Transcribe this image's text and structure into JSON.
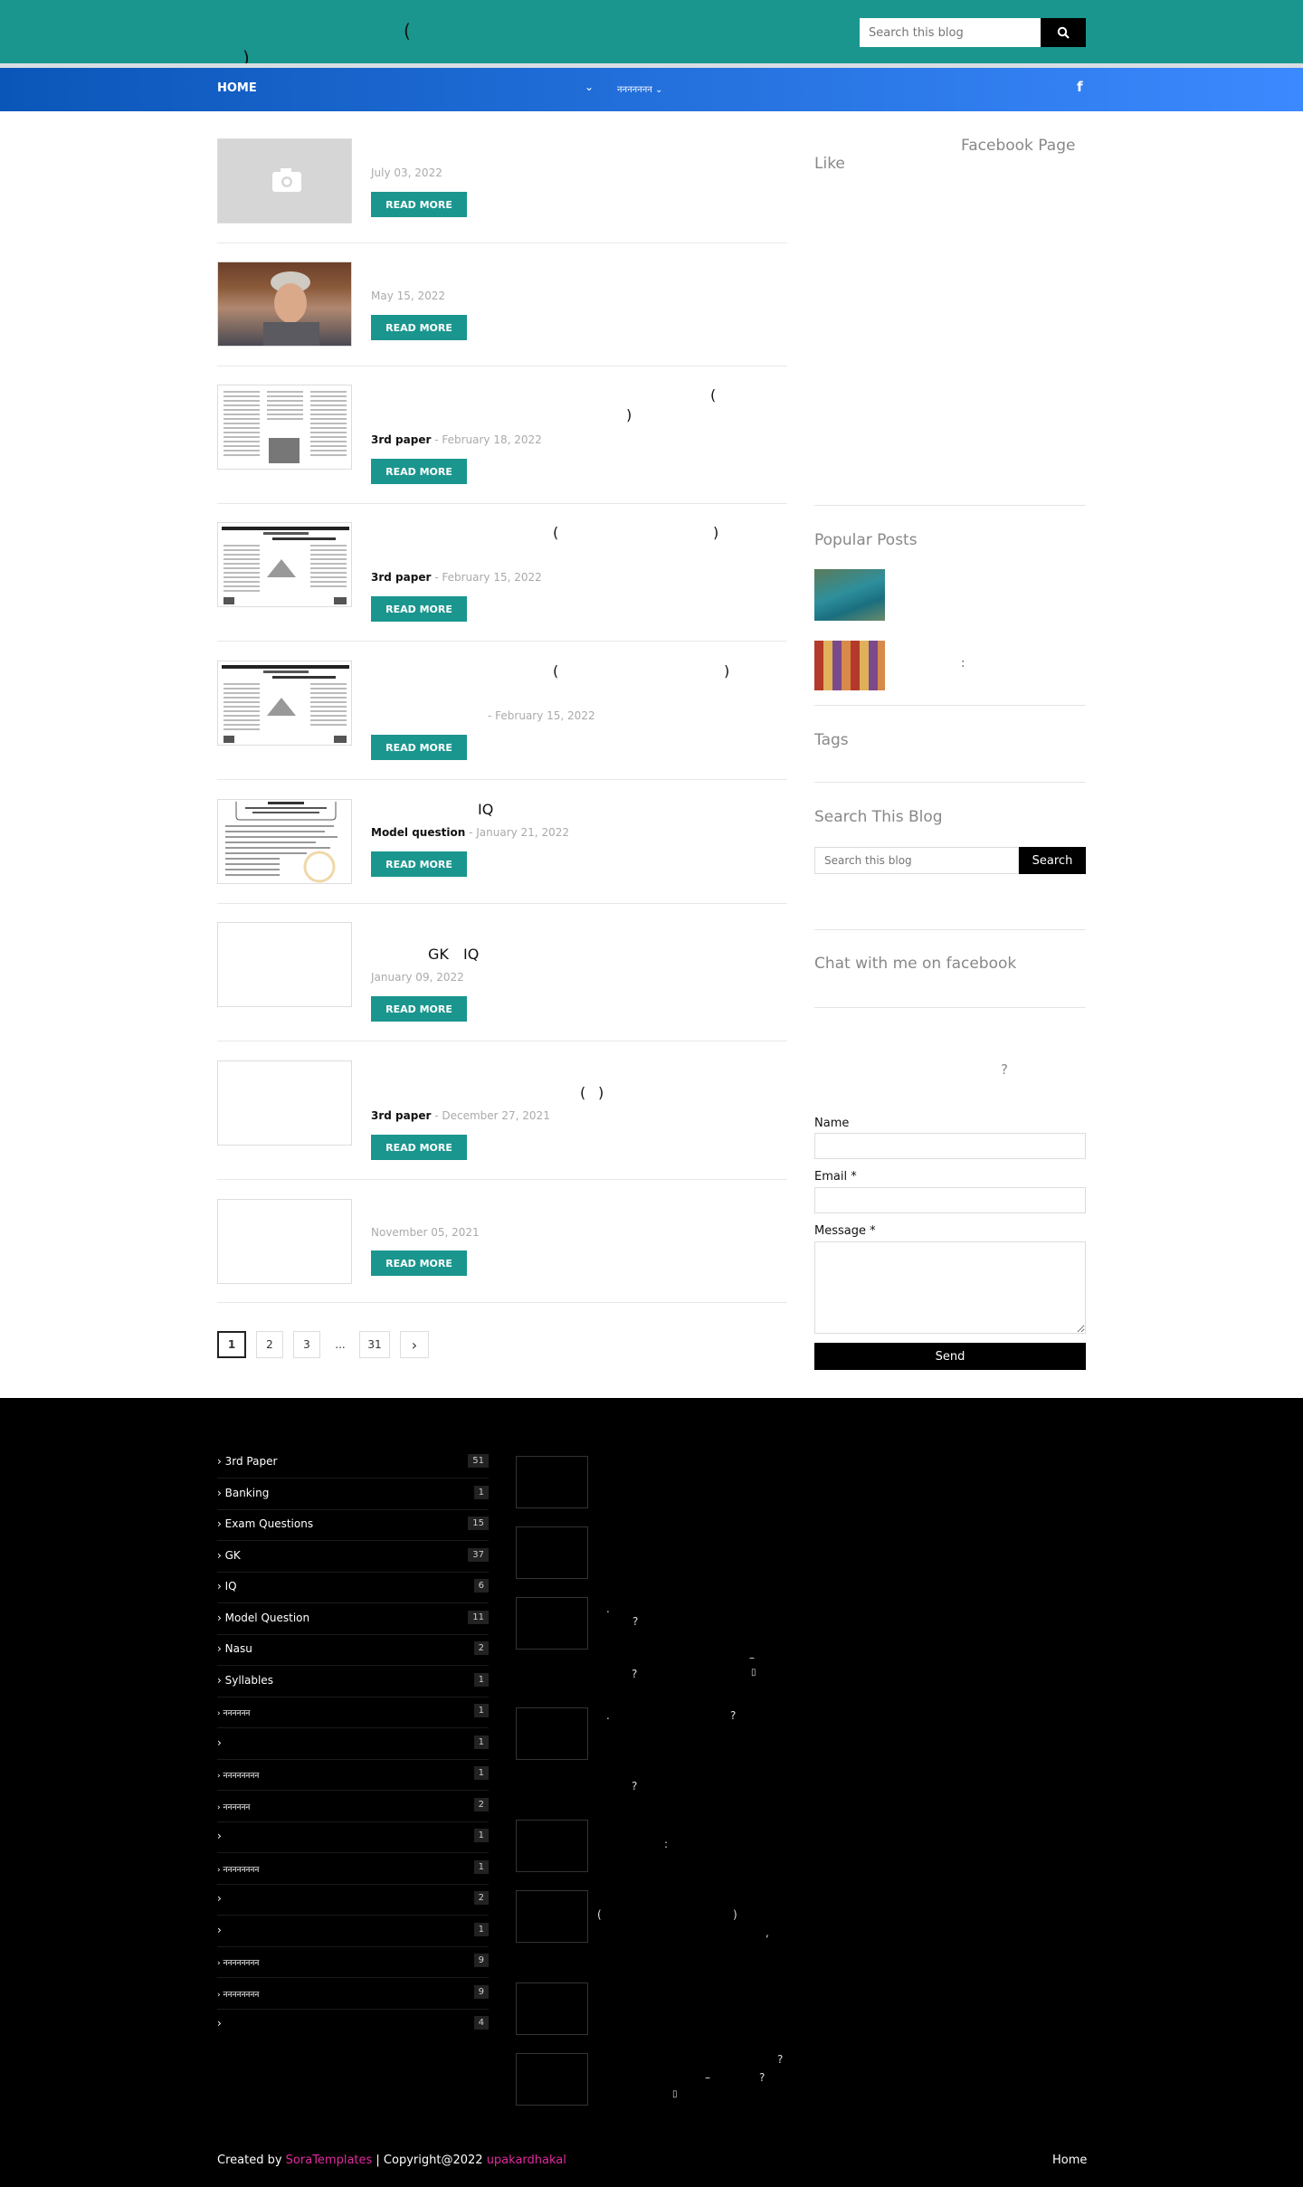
{
  "header": {
    "title_line1": "(",
    "title_line2": ")",
    "search_placeholder": "Search this blog",
    "search_icon": "magnifier-icon"
  },
  "nav": {
    "home": "HOME",
    "dropdown1_chevron": "⌄",
    "dropdown2": "ननननननन ⌄",
    "facebook": "f"
  },
  "posts": [
    {
      "title": "",
      "date": "July 03, 2022",
      "label": "",
      "read_more": "READ MORE"
    },
    {
      "title": "",
      "date": "May 15, 2022",
      "label": "",
      "read_more": "READ MORE"
    },
    {
      "title_a": "(",
      "title_b": ")",
      "label": "3rd paper",
      "date": "February 18, 2022",
      "read_more": "READ MORE"
    },
    {
      "title_a": "(",
      "title_b": ")",
      "label": "3rd paper",
      "date": "February 15, 2022",
      "read_more": "READ MORE"
    },
    {
      "title_a": "(",
      "title_b": ")",
      "label": "",
      "date": "February 15, 2022",
      "read_more": "READ MORE"
    },
    {
      "title": "IQ",
      "label": "Model question",
      "date": "January 21, 2022",
      "read_more": "READ MORE"
    },
    {
      "title_a": "GK",
      "title_b": "IQ",
      "label": "",
      "date": "January 09, 2022",
      "read_more": "READ MORE"
    },
    {
      "title_a": "(",
      "title_b": ")",
      "label": "3rd paper",
      "date": "December 27, 2021",
      "read_more": "READ MORE"
    },
    {
      "title": "",
      "label": "",
      "date": "November 05, 2021",
      "read_more": "READ MORE"
    }
  ],
  "pagination": [
    "1",
    "2",
    "3",
    "...",
    "31",
    "›"
  ],
  "sidebar": {
    "facebook_heading": "Facebook Page",
    "facebook_like": "Like",
    "popular_heading": "Popular Posts",
    "popular_colon": ":",
    "tags_heading": "Tags",
    "search_heading": "Search This Blog",
    "search_placeholder": "Search this blog",
    "search_button": "Search",
    "chat_heading": "Chat with me on facebook",
    "contact_question": "?",
    "name_label": "Name",
    "email_label": "Email *",
    "message_label": "Message *",
    "send": "Send"
  },
  "footer": {
    "categories": [
      {
        "name": "› 3rd Paper",
        "count": "51"
      },
      {
        "name": "› Banking",
        "count": "1"
      },
      {
        "name": "› Exam Questions",
        "count": "15"
      },
      {
        "name": "› GK",
        "count": "37"
      },
      {
        "name": "› IQ",
        "count": "6"
      },
      {
        "name": "› Model Question",
        "count": "11"
      },
      {
        "name": "› Nasu",
        "count": "2"
      },
      {
        "name": "› Syllables",
        "count": "1"
      },
      {
        "name": "› नननननन",
        "count": "1"
      },
      {
        "name": "›",
        "count": "1"
      },
      {
        "name": "› नननननननन",
        "count": "1"
      },
      {
        "name": "› नननननन",
        "count": "2"
      },
      {
        "name": "›",
        "count": "1"
      },
      {
        "name": "› नननननननन",
        "count": "1"
      },
      {
        "name": "›",
        "count": "2"
      },
      {
        "name": "›",
        "count": "1"
      },
      {
        "name": "› नननननननन",
        "count": "9"
      },
      {
        "name": "› नननननननन",
        "count": "9"
      },
      {
        "name": "›",
        "count": "4"
      }
    ],
    "frag1": ".",
    "frag2": "?",
    "frag3": "–",
    "frag4": "?",
    "frag5": "▯",
    "frag6": ".",
    "frag7": "?",
    "frag8": "?",
    "frag9": ":",
    "frag10": "(",
    "frag11": ")",
    "frag12": ",",
    "frag13": "?",
    "frag14": "–",
    "frag15": "?",
    "frag16": "▯",
    "credit_prefix": "Created by",
    "credit_brand": "SoraTemplates",
    "credit_mid": "| Copyright@2022",
    "credit_owner": "upakardhakal",
    "home": "Home"
  }
}
